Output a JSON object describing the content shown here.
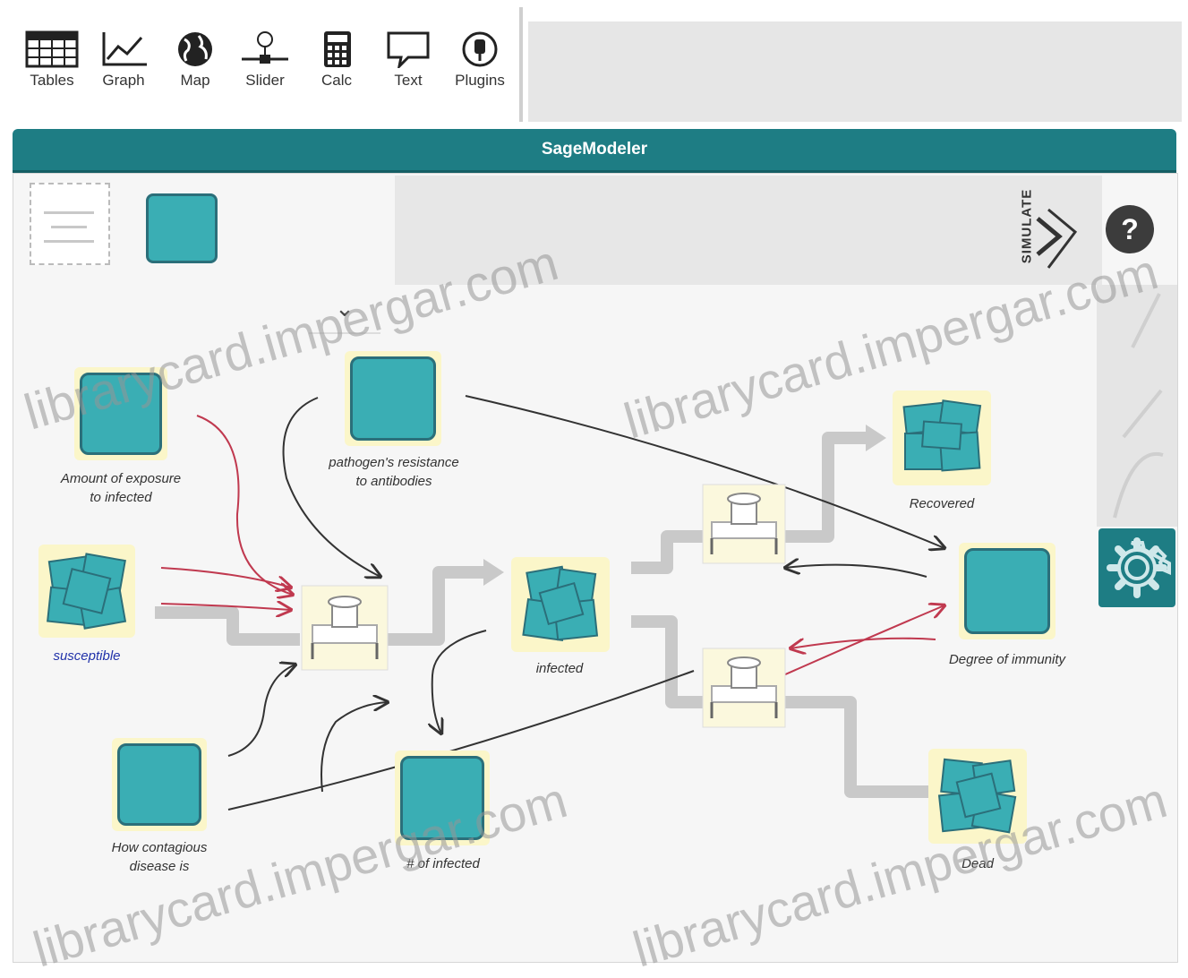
{
  "toolbar": {
    "items": [
      {
        "label": "Tables",
        "icon": "table-icon"
      },
      {
        "label": "Graph",
        "icon": "graph-icon"
      },
      {
        "label": "Map",
        "icon": "globe-icon"
      },
      {
        "label": "Slider",
        "icon": "slider-icon"
      },
      {
        "label": "Calc",
        "icon": "calculator-icon"
      },
      {
        "label": "Text",
        "icon": "speech-bubble-icon"
      },
      {
        "label": "Plugins",
        "icon": "plugin-icon"
      }
    ]
  },
  "document": {
    "title": "SageModeler"
  },
  "canvas": {
    "simulate_label": "SIMULATE",
    "help_label": "?",
    "collapse_glyph": "⌄"
  },
  "nodes": {
    "exposure": {
      "label": "Amount of exposure to infected"
    },
    "resistance": {
      "label": "pathogen's resistance to antibodies"
    },
    "susceptible": {
      "label": "susceptible"
    },
    "infected": {
      "label": "infected"
    },
    "recovered": {
      "label": "Recovered"
    },
    "immunity": {
      "label": "Degree of immunity"
    },
    "contagious": {
      "label": "How contagious disease is"
    },
    "num_infected": {
      "label": "# of infected"
    },
    "dead": {
      "label": "Dead"
    }
  },
  "watermark": {
    "text": "librarycard.impergar.com"
  },
  "colors": {
    "accent": "#1e7d84",
    "node_fill": "#3aaeb4",
    "node_border": "#2b6f7a",
    "halo": "#fbf6c9",
    "link_red": "#c0394f",
    "link_dark": "#333333"
  }
}
